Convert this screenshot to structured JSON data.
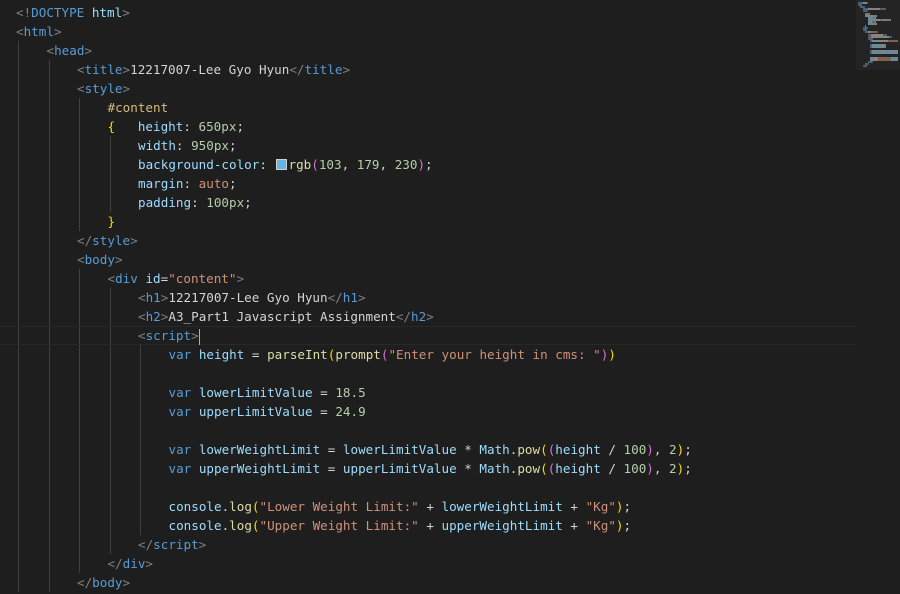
{
  "editor": {
    "language": "html",
    "swatch_color": "#67b3e6",
    "lines": [
      {
        "indent": 0,
        "tokens": [
          {
            "c": "punc",
            "t": "<!"
          },
          {
            "c": "tag",
            "t": "DOCTYPE"
          },
          {
            "c": "text",
            "t": " "
          },
          {
            "c": "attr",
            "t": "html"
          },
          {
            "c": "punc",
            "t": ">"
          }
        ]
      },
      {
        "indent": 0,
        "tokens": [
          {
            "c": "punc",
            "t": "<"
          },
          {
            "c": "tag",
            "t": "html"
          },
          {
            "c": "punc",
            "t": ">"
          }
        ]
      },
      {
        "indent": 1,
        "tokens": [
          {
            "c": "punc",
            "t": "<"
          },
          {
            "c": "tag",
            "t": "head"
          },
          {
            "c": "punc",
            "t": ">"
          }
        ]
      },
      {
        "indent": 2,
        "tokens": [
          {
            "c": "punc",
            "t": "<"
          },
          {
            "c": "tag",
            "t": "title"
          },
          {
            "c": "punc",
            "t": ">"
          },
          {
            "c": "text",
            "t": "12217007-Lee Gyo Hyun"
          },
          {
            "c": "punc",
            "t": "</"
          },
          {
            "c": "tag",
            "t": "title"
          },
          {
            "c": "punc",
            "t": ">"
          }
        ]
      },
      {
        "indent": 2,
        "tokens": [
          {
            "c": "punc",
            "t": "<"
          },
          {
            "c": "tag",
            "t": "style"
          },
          {
            "c": "punc",
            "t": ">"
          }
        ]
      },
      {
        "indent": 3,
        "tokens": [
          {
            "c": "sel",
            "t": "#content"
          }
        ]
      },
      {
        "indent": 3,
        "tokens": [
          {
            "c": "yel",
            "t": "{"
          },
          {
            "c": "text",
            "t": "   "
          },
          {
            "c": "attr",
            "t": "height"
          },
          {
            "c": "text",
            "t": ": "
          },
          {
            "c": "num",
            "t": "650px"
          },
          {
            "c": "text",
            "t": ";"
          }
        ]
      },
      {
        "indent": 4,
        "tokens": [
          {
            "c": "attr",
            "t": "width"
          },
          {
            "c": "text",
            "t": ": "
          },
          {
            "c": "num",
            "t": "950px"
          },
          {
            "c": "text",
            "t": ";"
          }
        ]
      },
      {
        "indent": 4,
        "tokens": [
          {
            "c": "attr",
            "t": "background-color"
          },
          {
            "c": "text",
            "t": ": "
          },
          {
            "c": "swatch",
            "t": ""
          },
          {
            "c": "fn",
            "t": "rgb"
          },
          {
            "c": "pink",
            "t": "("
          },
          {
            "c": "num",
            "t": "103"
          },
          {
            "c": "text",
            "t": ", "
          },
          {
            "c": "num",
            "t": "179"
          },
          {
            "c": "text",
            "t": ", "
          },
          {
            "c": "num",
            "t": "230"
          },
          {
            "c": "pink",
            "t": ")"
          },
          {
            "c": "text",
            "t": ";"
          }
        ]
      },
      {
        "indent": 4,
        "tokens": [
          {
            "c": "attr",
            "t": "margin"
          },
          {
            "c": "text",
            "t": ": "
          },
          {
            "c": "str",
            "t": "auto"
          },
          {
            "c": "text",
            "t": ";"
          }
        ]
      },
      {
        "indent": 4,
        "tokens": [
          {
            "c": "attr",
            "t": "padding"
          },
          {
            "c": "text",
            "t": ": "
          },
          {
            "c": "num",
            "t": "100px"
          },
          {
            "c": "text",
            "t": ";"
          }
        ]
      },
      {
        "indent": 3,
        "tokens": [
          {
            "c": "yel",
            "t": "}"
          }
        ]
      },
      {
        "indent": 2,
        "tokens": [
          {
            "c": "punc",
            "t": "</"
          },
          {
            "c": "tag",
            "t": "style"
          },
          {
            "c": "punc",
            "t": ">"
          }
        ]
      },
      {
        "indent": 2,
        "tokens": [
          {
            "c": "punc",
            "t": "<"
          },
          {
            "c": "tag",
            "t": "body"
          },
          {
            "c": "punc",
            "t": ">"
          }
        ]
      },
      {
        "indent": 3,
        "tokens": [
          {
            "c": "punc",
            "t": "<"
          },
          {
            "c": "tag",
            "t": "div"
          },
          {
            "c": "text",
            "t": " "
          },
          {
            "c": "attr",
            "t": "id"
          },
          {
            "c": "text",
            "t": "="
          },
          {
            "c": "str",
            "t": "\"content\""
          },
          {
            "c": "punc",
            "t": ">"
          }
        ]
      },
      {
        "indent": 4,
        "tokens": [
          {
            "c": "punc",
            "t": "<"
          },
          {
            "c": "tag",
            "t": "h1"
          },
          {
            "c": "punc",
            "t": ">"
          },
          {
            "c": "text",
            "t": "12217007-Lee Gyo Hyun"
          },
          {
            "c": "punc",
            "t": "</"
          },
          {
            "c": "tag",
            "t": "h1"
          },
          {
            "c": "punc",
            "t": ">"
          }
        ]
      },
      {
        "indent": 4,
        "tokens": [
          {
            "c": "punc",
            "t": "<"
          },
          {
            "c": "tag",
            "t": "h2"
          },
          {
            "c": "punc",
            "t": ">"
          },
          {
            "c": "text",
            "t": "A3_Part1 Javascript Assignment"
          },
          {
            "c": "punc",
            "t": "</"
          },
          {
            "c": "tag",
            "t": "h2"
          },
          {
            "c": "punc",
            "t": ">"
          }
        ]
      },
      {
        "indent": 4,
        "current": true,
        "tokens": [
          {
            "c": "punc",
            "t": "<"
          },
          {
            "c": "tag",
            "t": "script"
          },
          {
            "c": "punc",
            "t": ">"
          },
          {
            "c": "cursor",
            "t": ""
          }
        ]
      },
      {
        "indent": 5,
        "tokens": [
          {
            "c": "kw",
            "t": "var"
          },
          {
            "c": "text",
            "t": " "
          },
          {
            "c": "var",
            "t": "height"
          },
          {
            "c": "op",
            "t": " = "
          },
          {
            "c": "fn",
            "t": "parseInt"
          },
          {
            "c": "yel",
            "t": "("
          },
          {
            "c": "fn",
            "t": "prompt"
          },
          {
            "c": "pink",
            "t": "("
          },
          {
            "c": "str",
            "t": "\"Enter your height in cms: \""
          },
          {
            "c": "pink",
            "t": ")"
          },
          {
            "c": "yel",
            "t": ")"
          }
        ]
      },
      {
        "indent": 5,
        "tokens": []
      },
      {
        "indent": 5,
        "tokens": [
          {
            "c": "kw",
            "t": "var"
          },
          {
            "c": "text",
            "t": " "
          },
          {
            "c": "var",
            "t": "lowerLimitValue"
          },
          {
            "c": "op",
            "t": " = "
          },
          {
            "c": "num",
            "t": "18.5"
          }
        ]
      },
      {
        "indent": 5,
        "tokens": [
          {
            "c": "kw",
            "t": "var"
          },
          {
            "c": "text",
            "t": " "
          },
          {
            "c": "var",
            "t": "upperLimitValue"
          },
          {
            "c": "op",
            "t": " = "
          },
          {
            "c": "num",
            "t": "24.9"
          }
        ]
      },
      {
        "indent": 5,
        "tokens": []
      },
      {
        "indent": 5,
        "tokens": [
          {
            "c": "kw",
            "t": "var"
          },
          {
            "c": "text",
            "t": " "
          },
          {
            "c": "var",
            "t": "lowerWeightLimit"
          },
          {
            "c": "op",
            "t": " = "
          },
          {
            "c": "var",
            "t": "lowerLimitValue"
          },
          {
            "c": "op",
            "t": " * "
          },
          {
            "c": "var",
            "t": "Math"
          },
          {
            "c": "text",
            "t": "."
          },
          {
            "c": "fn",
            "t": "pow"
          },
          {
            "c": "yel",
            "t": "("
          },
          {
            "c": "pink",
            "t": "("
          },
          {
            "c": "var",
            "t": "height"
          },
          {
            "c": "op",
            "t": " / "
          },
          {
            "c": "num",
            "t": "100"
          },
          {
            "c": "pink",
            "t": ")"
          },
          {
            "c": "text",
            "t": ", "
          },
          {
            "c": "num",
            "t": "2"
          },
          {
            "c": "yel",
            "t": ")"
          },
          {
            "c": "text",
            "t": ";"
          }
        ]
      },
      {
        "indent": 5,
        "tokens": [
          {
            "c": "kw",
            "t": "var"
          },
          {
            "c": "text",
            "t": " "
          },
          {
            "c": "var",
            "t": "upperWeightLimit"
          },
          {
            "c": "op",
            "t": " = "
          },
          {
            "c": "var",
            "t": "upperLimitValue"
          },
          {
            "c": "op",
            "t": " * "
          },
          {
            "c": "var",
            "t": "Math"
          },
          {
            "c": "text",
            "t": "."
          },
          {
            "c": "fn",
            "t": "pow"
          },
          {
            "c": "yel",
            "t": "("
          },
          {
            "c": "pink",
            "t": "("
          },
          {
            "c": "var",
            "t": "height"
          },
          {
            "c": "op",
            "t": " / "
          },
          {
            "c": "num",
            "t": "100"
          },
          {
            "c": "pink",
            "t": ")"
          },
          {
            "c": "text",
            "t": ", "
          },
          {
            "c": "num",
            "t": "2"
          },
          {
            "c": "yel",
            "t": ")"
          },
          {
            "c": "text",
            "t": ";"
          }
        ]
      },
      {
        "indent": 5,
        "tokens": []
      },
      {
        "indent": 5,
        "tokens": [
          {
            "c": "var",
            "t": "console"
          },
          {
            "c": "text",
            "t": "."
          },
          {
            "c": "fn",
            "t": "log"
          },
          {
            "c": "yel",
            "t": "("
          },
          {
            "c": "str",
            "t": "\"Lower Weight Limit:\""
          },
          {
            "c": "op",
            "t": " + "
          },
          {
            "c": "var",
            "t": "lowerWeightLimit"
          },
          {
            "c": "op",
            "t": " + "
          },
          {
            "c": "str",
            "t": "\"Kg\""
          },
          {
            "c": "yel",
            "t": ")"
          },
          {
            "c": "text",
            "t": ";"
          }
        ]
      },
      {
        "indent": 5,
        "tokens": [
          {
            "c": "var",
            "t": "console"
          },
          {
            "c": "text",
            "t": "."
          },
          {
            "c": "fn",
            "t": "log"
          },
          {
            "c": "yel",
            "t": "("
          },
          {
            "c": "str",
            "t": "\"Upper Weight Limit:\""
          },
          {
            "c": "op",
            "t": " + "
          },
          {
            "c": "var",
            "t": "upperWeightLimit"
          },
          {
            "c": "op",
            "t": " + "
          },
          {
            "c": "str",
            "t": "\"Kg\""
          },
          {
            "c": "yel",
            "t": ")"
          },
          {
            "c": "text",
            "t": ";"
          }
        ]
      },
      {
        "indent": 4,
        "tokens": [
          {
            "c": "punc",
            "t": "</"
          },
          {
            "c": "tag",
            "t": "script"
          },
          {
            "c": "punc",
            "t": ">"
          }
        ]
      },
      {
        "indent": 3,
        "tokens": [
          {
            "c": "punc",
            "t": "</"
          },
          {
            "c": "tag",
            "t": "div"
          },
          {
            "c": "punc",
            "t": ">"
          }
        ]
      },
      {
        "indent": 2,
        "tokens": [
          {
            "c": "punc",
            "t": "</"
          },
          {
            "c": "tag",
            "t": "body"
          },
          {
            "c": "punc",
            "t": ">"
          }
        ]
      }
    ]
  },
  "colors": {
    "background": "#1e1e1e",
    "indent_guide": "#404040",
    "tag": "#569cd6",
    "string": "#ce9178",
    "attribute": "#9cdcfe",
    "number": "#b5cea8",
    "function": "#dcdcaa"
  }
}
